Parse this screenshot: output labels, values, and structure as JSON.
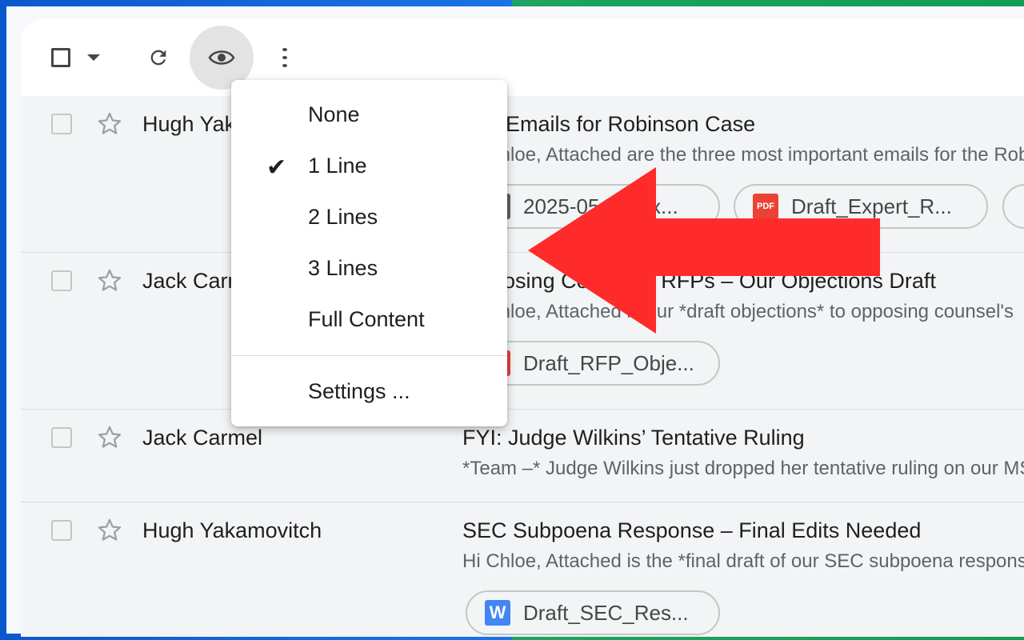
{
  "toolbar": {
    "select_icon": "checkbox-icon",
    "select_dropdown_icon": "caret-down-icon",
    "refresh_icon": "refresh-icon",
    "density_icon": "eye-icon",
    "more_icon": "more-vert-icon"
  },
  "menu": {
    "items": [
      "None",
      "1 Line",
      "2 Lines",
      "3 Lines",
      "Full Content"
    ],
    "selected": "1 Line",
    "check_glyph": "✔",
    "settings_label": "Settings ..."
  },
  "emails": [
    {
      "sender": "Hugh Yakamovitch",
      "subject": "Key Emails for Robinson Case",
      "snippet": "Hi Chloe, Attached are the three most important emails for the Robinson case",
      "attachments": [
        {
          "name": "2025-05-09-Ex...",
          "type": "generic"
        },
        {
          "name": "Draft_Expert_R...",
          "type": "pdf"
        }
      ]
    },
    {
      "sender": "Jack Carmel",
      "subject": "Opposing Counsel's RFPs – Our Objections Draft",
      "snippet": "Hi Chloe, Attached is our *draft objections* to opposing counsel's",
      "attachments": [
        {
          "name": "Draft_RFP_Obje...",
          "type": "pdf"
        }
      ]
    },
    {
      "sender": "Jack Carmel",
      "subject": "FYI: Judge Wilkins’ Tentative Ruling",
      "snippet": "*Team –* Judge Wilkins just dropped her tentative ruling on our MSJ",
      "attachments": []
    },
    {
      "sender": "Hugh Yakamovitch",
      "subject": "SEC Subpoena Response – Final Edits Needed",
      "snippet": "Hi Chloe, Attached is the *final draft of our SEC subpoena response",
      "attachments": [
        {
          "name": "Draft_SEC_Res...",
          "type": "word"
        }
      ]
    }
  ],
  "icons": {
    "pdf_label": "PDF",
    "word_label": "W"
  },
  "colors": {
    "annotation_arrow": "#ff2a2a",
    "pdf": "#ea4335",
    "word": "#4285f4"
  }
}
